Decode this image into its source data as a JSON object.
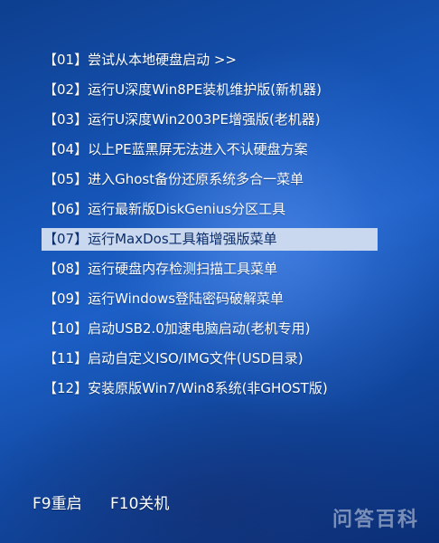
{
  "menu": {
    "items": [
      {
        "label": "【01】尝试从本地硬盘启动 >>"
      },
      {
        "label": "【02】运行U深度Win8PE装机维护版(新机器)"
      },
      {
        "label": "【03】运行U深度Win2003PE增强版(老机器)"
      },
      {
        "label": "【04】以上PE蓝黑屏无法进入不认硬盘方案"
      },
      {
        "label": "【05】进入Ghost备份还原系统多合一菜单"
      },
      {
        "label": "【06】运行最新版DiskGenius分区工具"
      },
      {
        "label": "【07】运行MaxDos工具箱增强版菜单"
      },
      {
        "label": "【08】运行硬盘内存检测扫描工具菜单"
      },
      {
        "label": "【09】运行Windows登陆密码破解菜单"
      },
      {
        "label": "【10】启动USB2.0加速电脑启动(老机专用)"
      },
      {
        "label": "【11】启动自定义ISO/IMG文件(USD目录)"
      },
      {
        "label": "【12】安装原版Win7/Win8系统(非GHOST版)"
      }
    ],
    "selected_index": 6
  },
  "footer": {
    "reboot": "F9重启",
    "shutdown": "F10关机"
  },
  "watermark": "问答百科",
  "colors": {
    "background": "#1656b9",
    "selected_bg": "#c9d8ee",
    "selected_text": "#0b2d6b",
    "text": "#ffffff"
  }
}
